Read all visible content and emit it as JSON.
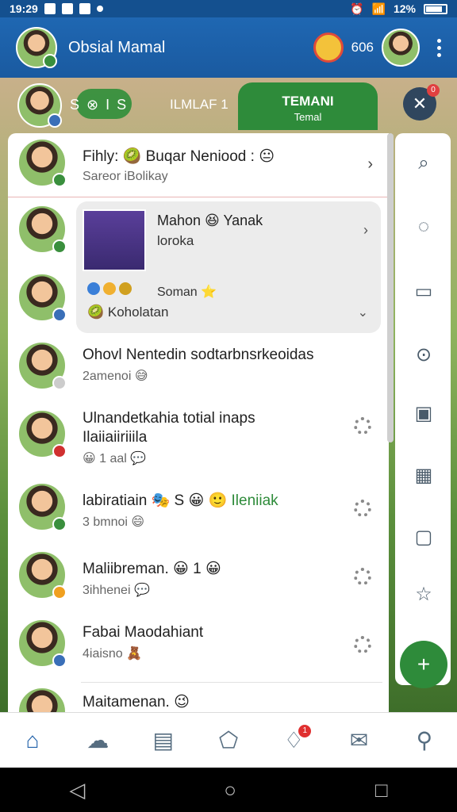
{
  "status_bar": {
    "time": "19:29",
    "battery": "12%"
  },
  "app_bar": {
    "title": "Obsial Mamal",
    "count": "606"
  },
  "tabs": {
    "tab1_label": "S",
    "tab1_suffix": "S",
    "tab2_label": "ILMLAF 1",
    "active_title": "TEMANI",
    "active_subtitle": "Temal",
    "close_badge": "0"
  },
  "rows": [
    {
      "name": "Fihly: 🥝 Buqar Neniood : 😐",
      "sub": "Sareor iBolikay"
    },
    {
      "name": "Ohovl Nentedin sodtarbnsrkeoidas",
      "sub": "2amenoi 😅"
    },
    {
      "name": "Ulnandetkahia totial inaps",
      "name2": "Ilaiiaiiriiila",
      "sub": "😀 1 aal 💬"
    },
    {
      "name": "labiratiain 🎭 S 😀 🙂",
      "highlight": "Ileniiak",
      "sub": "3 bmnoi 😄"
    },
    {
      "name": "Maliibreman. 😀 1 😀",
      "sub": "3ihhenei 💬"
    },
    {
      "name": "Fabai Maodahiant",
      "sub": "4iaisno 🧸"
    },
    {
      "name": "Maitamenan. 😉",
      "sub": ""
    }
  ],
  "expanded": {
    "title": "Mahon 😆 Yanak",
    "sub": "loroka",
    "summary": "Soman ⭐",
    "location": "🥝 Koholatan"
  },
  "rail_icons": [
    "search-icon",
    "chat-bubble-icon",
    "card-icon",
    "magnify-icon",
    "message-icon",
    "grid-icon",
    "comment-icon",
    "star-icon"
  ],
  "fab_label": "+",
  "nav": {
    "home": "home-icon",
    "friends": "friends-icon",
    "chat": "chat-icon",
    "box": "box-icon",
    "alerts": "alerts-icon",
    "inbox": "inbox-icon",
    "location": "location-icon",
    "alerts_badge": "1"
  },
  "colors": {
    "app_bar": "#1f67b2",
    "active_tab": "#2e8b3a",
    "fab": "#2e8b3a"
  }
}
